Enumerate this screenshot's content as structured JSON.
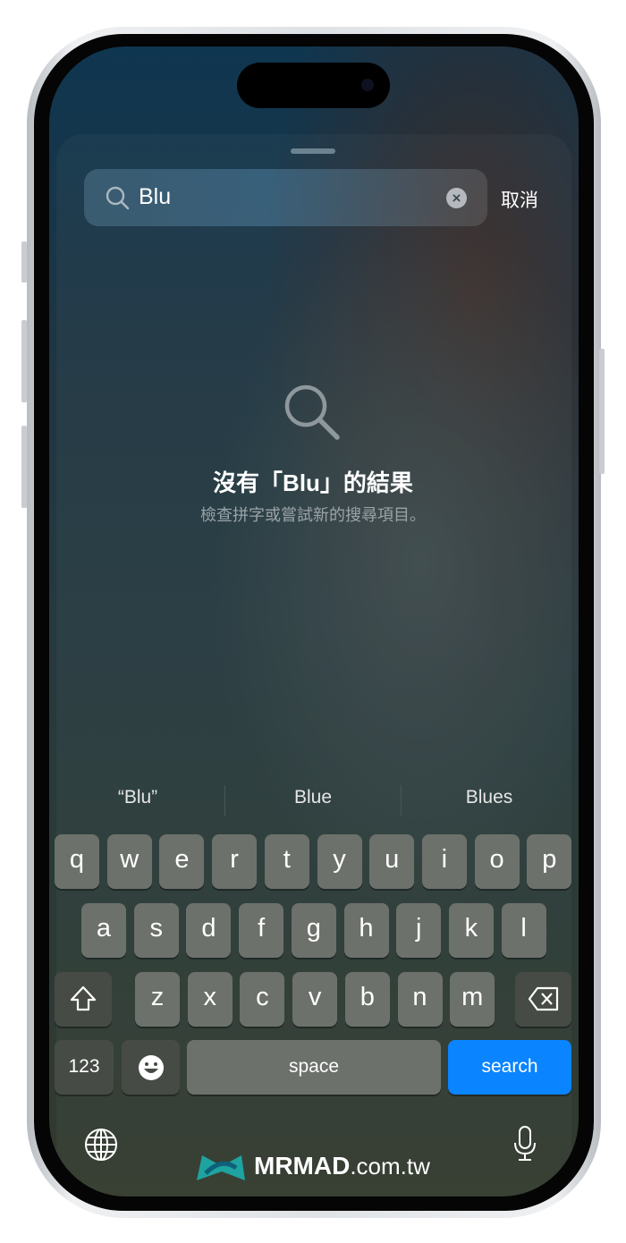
{
  "search": {
    "value": "Blu",
    "cancel_label": "取消"
  },
  "empty_state": {
    "title": "沒有「Blu」的結果",
    "subtitle": "檢查拼字或嘗試新的搜尋項目。"
  },
  "suggestions": [
    "“Blu”",
    "Blue",
    "Blues"
  ],
  "keyboard": {
    "rows": [
      [
        "q",
        "w",
        "e",
        "r",
        "t",
        "y",
        "u",
        "i",
        "o",
        "p"
      ],
      [
        "a",
        "s",
        "d",
        "f",
        "g",
        "h",
        "j",
        "k",
        "l"
      ],
      [
        "z",
        "x",
        "c",
        "v",
        "b",
        "n",
        "m"
      ]
    ],
    "numbers_label": "123",
    "space_label": "space",
    "search_label": "search"
  },
  "watermark": {
    "brand": "MRMAD",
    ".suffix": ".com.tw"
  },
  "colors": {
    "accent": "#0a84ff",
    "key": "#6d716b",
    "key_dark": "#474b45",
    "logo": "#1fa3a0"
  }
}
